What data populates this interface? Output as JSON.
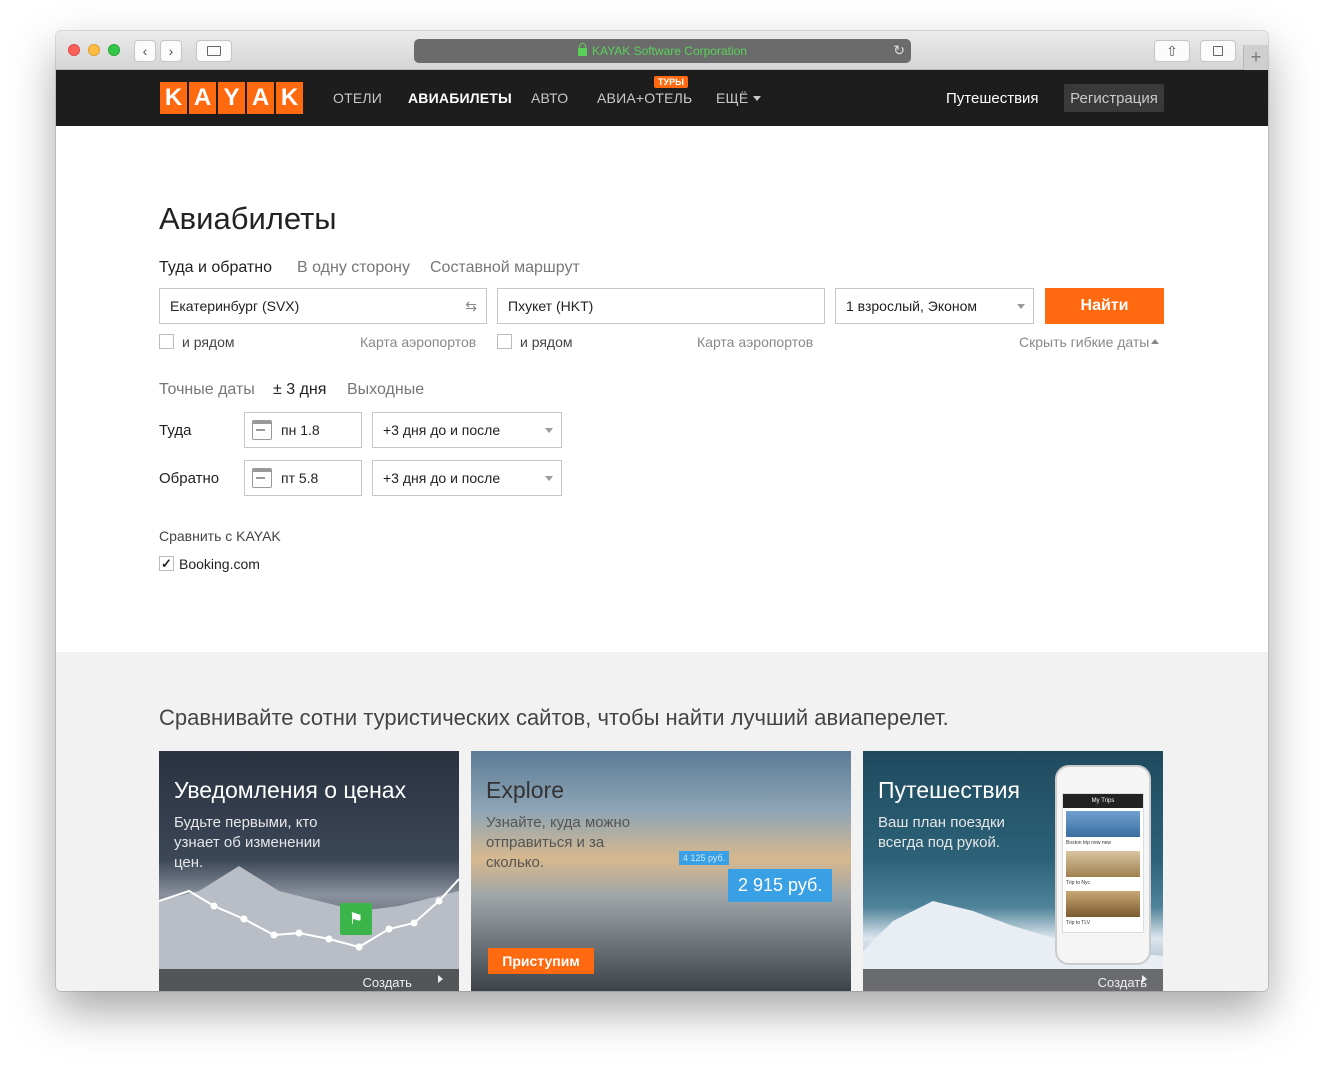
{
  "browser": {
    "url_text": "KAYAK Software Corporation"
  },
  "nav": {
    "logo": [
      "K",
      "A",
      "Y",
      "A",
      "K"
    ],
    "items": [
      "ОТЕЛИ",
      "АВИАБИЛЕТЫ",
      "АВТО",
      "АВИА+ОТЕЛЬ",
      "ЕЩЁ"
    ],
    "badge": "ТУРЫ",
    "trips": "Путешествия",
    "register": "Регистрация"
  },
  "search": {
    "title": "Авиабилеты",
    "trip_tabs": [
      "Туда и обратно",
      "В одну сторону",
      "Составной маршрут"
    ],
    "origin": "Екатеринбург (SVX)",
    "destination": "Пхукет (HKT)",
    "travelers": "1 взрослый, Эконом",
    "submit": "Найти",
    "nearby_label": "и рядом",
    "airport_map": "Карта аэропортов",
    "hide_flex": "Скрыть гибкие даты",
    "date_tabs": [
      "Точные даты",
      "± 3 дня",
      "Выходные"
    ],
    "depart_label": "Туда",
    "return_label": "Обратно",
    "depart_date": "пн 1.8",
    "return_date": "пт 5.8",
    "flex_option": "+3 дня до и после",
    "compare_title": "Сравнить с KAYAK",
    "compare_site": "Booking.com",
    "compare_checked": true
  },
  "promo": {
    "heading": "Сравнивайте сотни туристических сайтов, чтобы найти лучший авиаперелет.",
    "cards": [
      {
        "title": "Уведомления о ценах",
        "text": "Будьте первыми, кто узнает об изменении цен.",
        "footer": "Создать уведомление"
      },
      {
        "title": "Explore",
        "text": "Узнайте, куда можно отправиться и за сколько.",
        "button": "Приступим",
        "price_main": "2 915 руб.",
        "price_small": "4 125 руб."
      },
      {
        "title": "Путешествия",
        "text": "Ваш план поездки всегда под рукой.",
        "footer": "Создать поездку",
        "phone_header": "My Trips",
        "phone_items": [
          "Boston trip new new",
          "Trip to Nyc",
          "Trip to TLV"
        ]
      }
    ]
  },
  "colors": {
    "brand_orange": "#ff690f",
    "navbar_bg": "#1d1d1d",
    "price_blue": "#39a0e6",
    "alert_green": "#3bb54a"
  }
}
